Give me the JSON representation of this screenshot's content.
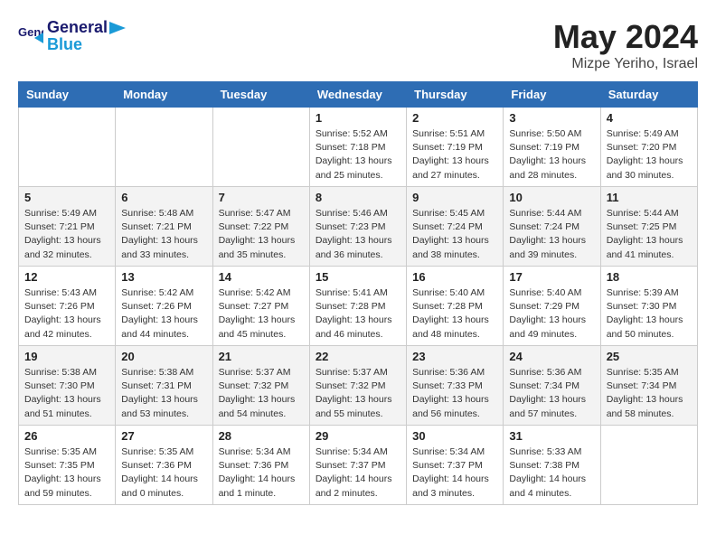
{
  "header": {
    "logo_line1": "General",
    "logo_line2": "Blue",
    "month_title": "May 2024",
    "location": "Mizpe Yeriho, Israel"
  },
  "days_of_week": [
    "Sunday",
    "Monday",
    "Tuesday",
    "Wednesday",
    "Thursday",
    "Friday",
    "Saturday"
  ],
  "weeks": [
    [
      {
        "day": "",
        "info": ""
      },
      {
        "day": "",
        "info": ""
      },
      {
        "day": "",
        "info": ""
      },
      {
        "day": "1",
        "info": "Sunrise: 5:52 AM\nSunset: 7:18 PM\nDaylight: 13 hours\nand 25 minutes."
      },
      {
        "day": "2",
        "info": "Sunrise: 5:51 AM\nSunset: 7:19 PM\nDaylight: 13 hours\nand 27 minutes."
      },
      {
        "day": "3",
        "info": "Sunrise: 5:50 AM\nSunset: 7:19 PM\nDaylight: 13 hours\nand 28 minutes."
      },
      {
        "day": "4",
        "info": "Sunrise: 5:49 AM\nSunset: 7:20 PM\nDaylight: 13 hours\nand 30 minutes."
      }
    ],
    [
      {
        "day": "5",
        "info": "Sunrise: 5:49 AM\nSunset: 7:21 PM\nDaylight: 13 hours\nand 32 minutes."
      },
      {
        "day": "6",
        "info": "Sunrise: 5:48 AM\nSunset: 7:21 PM\nDaylight: 13 hours\nand 33 minutes."
      },
      {
        "day": "7",
        "info": "Sunrise: 5:47 AM\nSunset: 7:22 PM\nDaylight: 13 hours\nand 35 minutes."
      },
      {
        "day": "8",
        "info": "Sunrise: 5:46 AM\nSunset: 7:23 PM\nDaylight: 13 hours\nand 36 minutes."
      },
      {
        "day": "9",
        "info": "Sunrise: 5:45 AM\nSunset: 7:24 PM\nDaylight: 13 hours\nand 38 minutes."
      },
      {
        "day": "10",
        "info": "Sunrise: 5:44 AM\nSunset: 7:24 PM\nDaylight: 13 hours\nand 39 minutes."
      },
      {
        "day": "11",
        "info": "Sunrise: 5:44 AM\nSunset: 7:25 PM\nDaylight: 13 hours\nand 41 minutes."
      }
    ],
    [
      {
        "day": "12",
        "info": "Sunrise: 5:43 AM\nSunset: 7:26 PM\nDaylight: 13 hours\nand 42 minutes."
      },
      {
        "day": "13",
        "info": "Sunrise: 5:42 AM\nSunset: 7:26 PM\nDaylight: 13 hours\nand 44 minutes."
      },
      {
        "day": "14",
        "info": "Sunrise: 5:42 AM\nSunset: 7:27 PM\nDaylight: 13 hours\nand 45 minutes."
      },
      {
        "day": "15",
        "info": "Sunrise: 5:41 AM\nSunset: 7:28 PM\nDaylight: 13 hours\nand 46 minutes."
      },
      {
        "day": "16",
        "info": "Sunrise: 5:40 AM\nSunset: 7:28 PM\nDaylight: 13 hours\nand 48 minutes."
      },
      {
        "day": "17",
        "info": "Sunrise: 5:40 AM\nSunset: 7:29 PM\nDaylight: 13 hours\nand 49 minutes."
      },
      {
        "day": "18",
        "info": "Sunrise: 5:39 AM\nSunset: 7:30 PM\nDaylight: 13 hours\nand 50 minutes."
      }
    ],
    [
      {
        "day": "19",
        "info": "Sunrise: 5:38 AM\nSunset: 7:30 PM\nDaylight: 13 hours\nand 51 minutes."
      },
      {
        "day": "20",
        "info": "Sunrise: 5:38 AM\nSunset: 7:31 PM\nDaylight: 13 hours\nand 53 minutes."
      },
      {
        "day": "21",
        "info": "Sunrise: 5:37 AM\nSunset: 7:32 PM\nDaylight: 13 hours\nand 54 minutes."
      },
      {
        "day": "22",
        "info": "Sunrise: 5:37 AM\nSunset: 7:32 PM\nDaylight: 13 hours\nand 55 minutes."
      },
      {
        "day": "23",
        "info": "Sunrise: 5:36 AM\nSunset: 7:33 PM\nDaylight: 13 hours\nand 56 minutes."
      },
      {
        "day": "24",
        "info": "Sunrise: 5:36 AM\nSunset: 7:34 PM\nDaylight: 13 hours\nand 57 minutes."
      },
      {
        "day": "25",
        "info": "Sunrise: 5:35 AM\nSunset: 7:34 PM\nDaylight: 13 hours\nand 58 minutes."
      }
    ],
    [
      {
        "day": "26",
        "info": "Sunrise: 5:35 AM\nSunset: 7:35 PM\nDaylight: 13 hours\nand 59 minutes."
      },
      {
        "day": "27",
        "info": "Sunrise: 5:35 AM\nSunset: 7:36 PM\nDaylight: 14 hours\nand 0 minutes."
      },
      {
        "day": "28",
        "info": "Sunrise: 5:34 AM\nSunset: 7:36 PM\nDaylight: 14 hours\nand 1 minute."
      },
      {
        "day": "29",
        "info": "Sunrise: 5:34 AM\nSunset: 7:37 PM\nDaylight: 14 hours\nand 2 minutes."
      },
      {
        "day": "30",
        "info": "Sunrise: 5:34 AM\nSunset: 7:37 PM\nDaylight: 14 hours\nand 3 minutes."
      },
      {
        "day": "31",
        "info": "Sunrise: 5:33 AM\nSunset: 7:38 PM\nDaylight: 14 hours\nand 4 minutes."
      },
      {
        "day": "",
        "info": ""
      }
    ]
  ]
}
